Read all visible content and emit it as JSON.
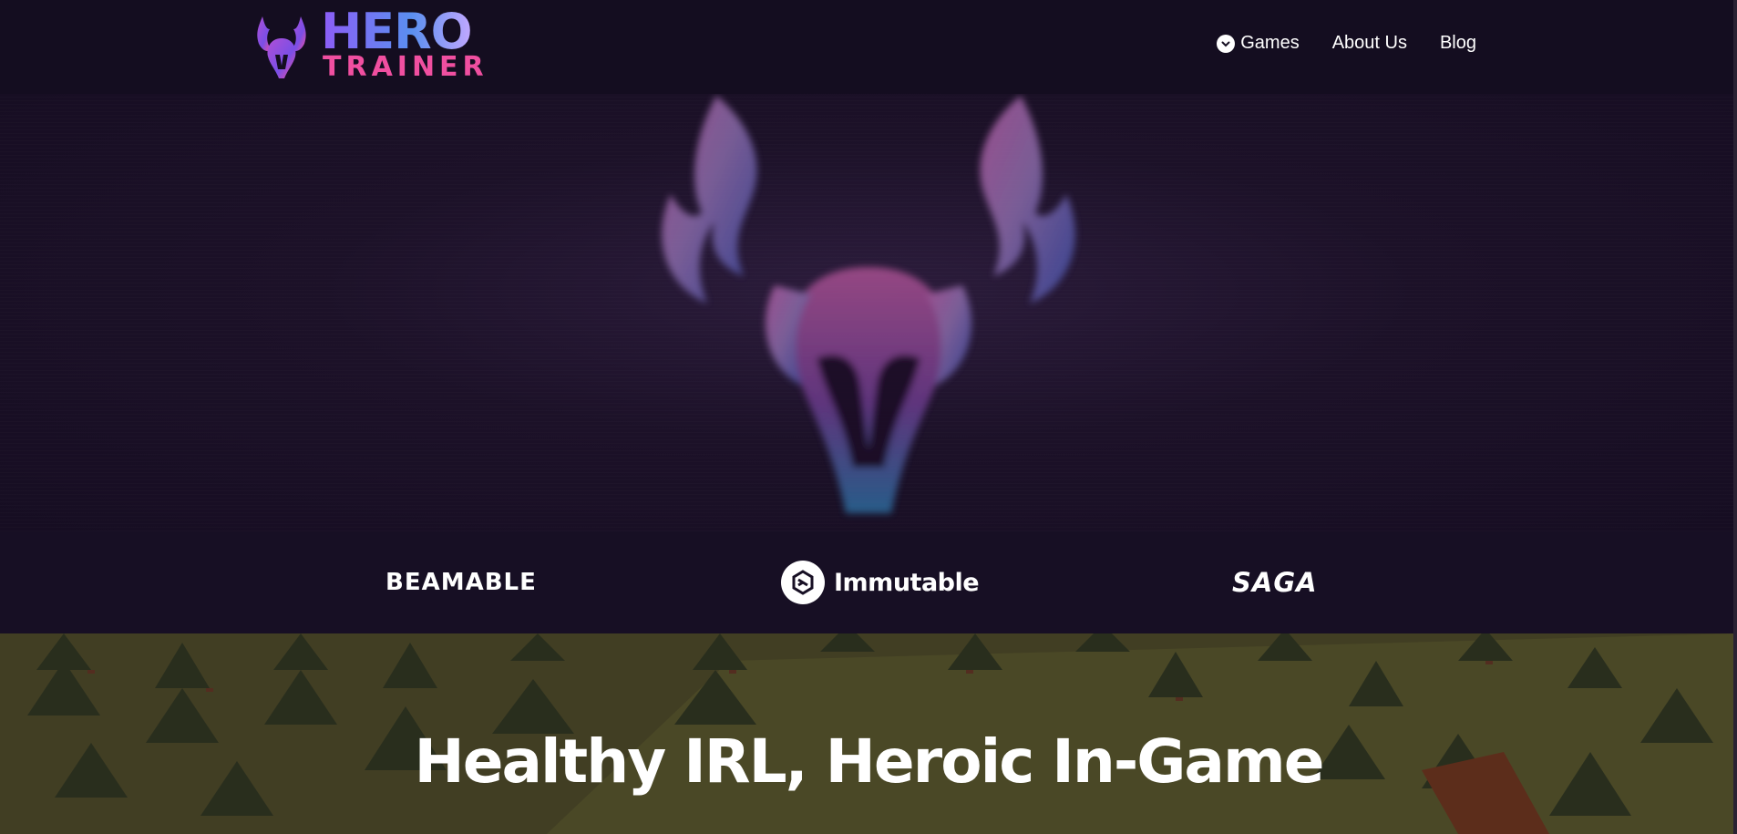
{
  "brand": {
    "name_top": "HERO",
    "name_bottom": "TRAINER"
  },
  "nav": {
    "items": [
      {
        "label": "Games",
        "icon": "chevron-down-icon"
      },
      {
        "label": "About Us"
      },
      {
        "label": "Blog"
      }
    ]
  },
  "partners": {
    "beamable": "BEAMABLE",
    "immutable": "Immutable",
    "saga": "SAGA"
  },
  "scene": {
    "headline": "Healthy IRL, Heroic In-Game"
  },
  "colors": {
    "background": "#140d1f",
    "brand_purple": "#8d5cf6",
    "brand_blue": "#5a8ff0",
    "brand_pink": "#f04fa0"
  }
}
